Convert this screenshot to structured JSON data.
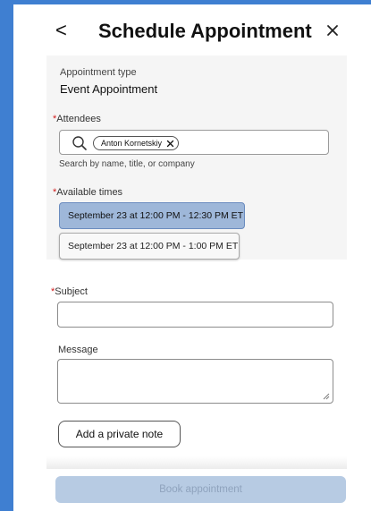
{
  "header": {
    "back_glyph": "<",
    "title": "Schedule Appointment"
  },
  "appointment_type": {
    "label": "Appointment type",
    "value": "Event Appointment"
  },
  "attendees": {
    "required_mark": "*",
    "label": "Attendees",
    "chips": [
      "Anton Kornetskiy"
    ],
    "helper": "Search by name, title, or company"
  },
  "available_times": {
    "required_mark": "*",
    "label": "Available times",
    "slots": [
      {
        "label": "September 23 at 12:00 PM - 12:30 PM ET",
        "selected": true
      },
      {
        "label": "September 23 at 12:00 PM - 1:00 PM ET",
        "selected": false
      }
    ]
  },
  "subject": {
    "required_mark": "*",
    "label": "Subject",
    "value": ""
  },
  "message": {
    "label": "Message",
    "value": ""
  },
  "buttons": {
    "private_note": "Add a private note",
    "book": "Book appointment"
  },
  "colors": {
    "frame_accent": "#3f7fd1",
    "selected_slot": "#9eb7d9",
    "required": "#d11b1b",
    "book_disabled_bg": "#b7cbe3"
  },
  "icons": {
    "close": "close-icon",
    "search": "search-icon",
    "chip_remove": "close-icon",
    "resize": "resize-handle-icon"
  }
}
